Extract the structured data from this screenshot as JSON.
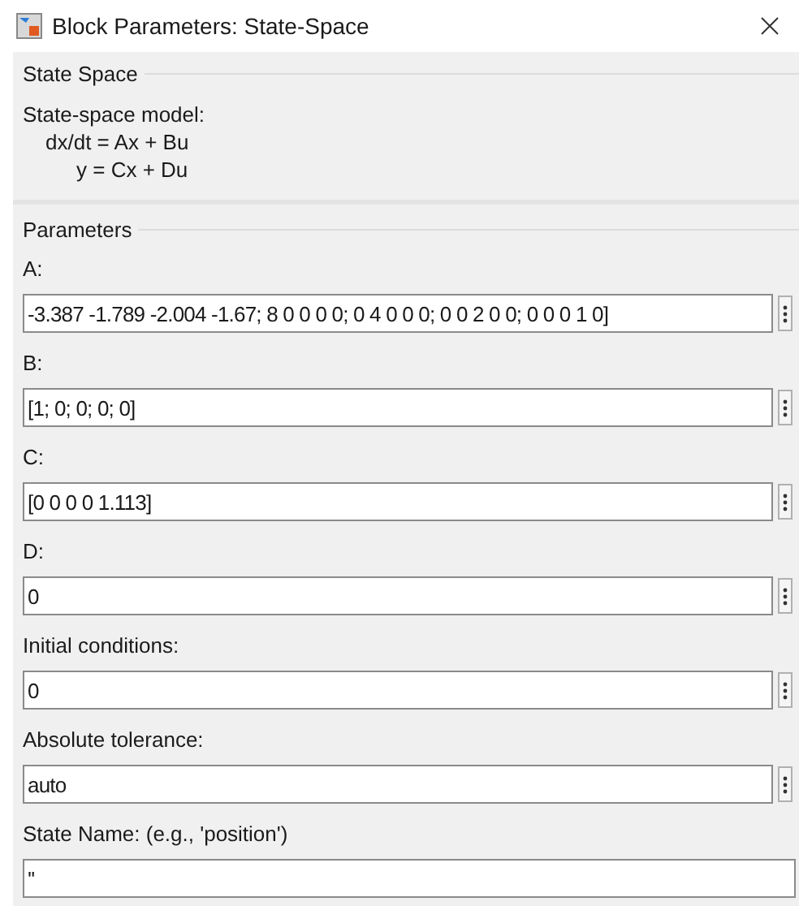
{
  "window": {
    "title": "Block Parameters: State-Space"
  },
  "block_section": {
    "title": "State Space",
    "description": [
      "State-space model:",
      "dx/dt = Ax + Bu",
      "y = Cx + Du"
    ]
  },
  "parameters_section": {
    "title": "Parameters",
    "fields": [
      {
        "label": "A:",
        "value": "-3.387 -1.789 -2.004 -1.67; 8 0 0 0 0; 0 4 0 0 0; 0 0 2 0 0; 0 0 0 1 0]",
        "has_menu": true
      },
      {
        "label": "B:",
        "value": "[1; 0; 0; 0; 0]",
        "has_menu": true
      },
      {
        "label": "C:",
        "value": "[0 0 0 0 1.113]",
        "has_menu": true
      },
      {
        "label": "D:",
        "value": "0",
        "has_menu": true
      },
      {
        "label": "Initial conditions:",
        "value": "0",
        "has_menu": true
      },
      {
        "label": "Absolute tolerance:",
        "value": "auto",
        "has_menu": true
      },
      {
        "label": "State Name: (e.g., 'position')",
        "value": "''",
        "has_menu": false
      }
    ]
  }
}
